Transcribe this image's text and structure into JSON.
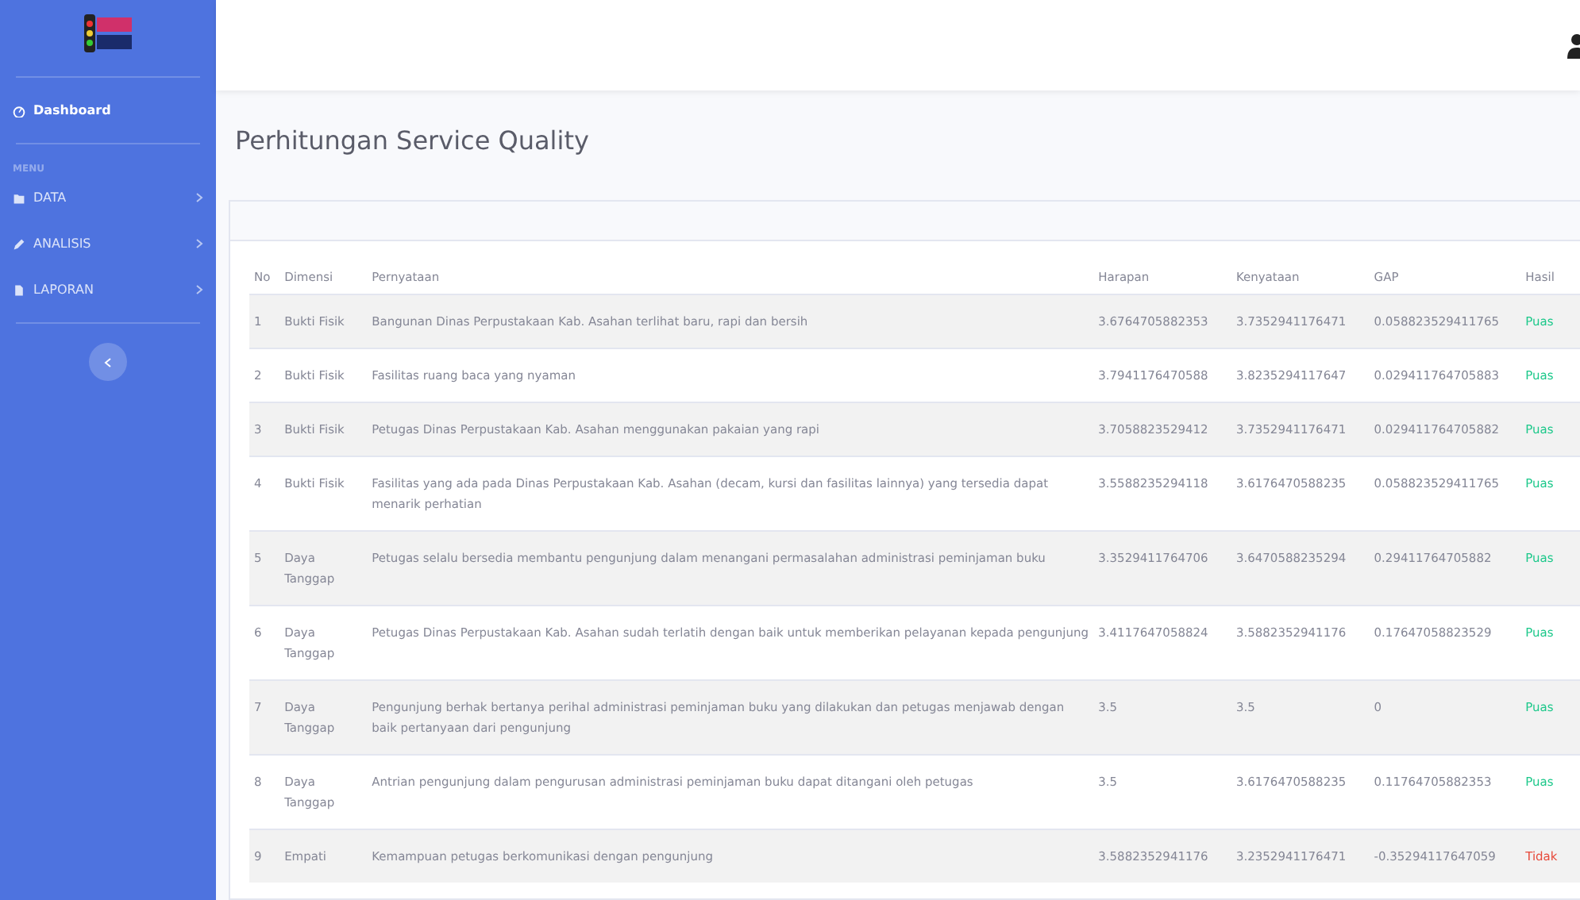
{
  "sidebar": {
    "items": [
      {
        "label": "Dashboard",
        "kind": "link",
        "selected": true
      },
      {
        "label": "MENU",
        "kind": "heading"
      },
      {
        "label": "DATA",
        "kind": "menu",
        "selected": false
      },
      {
        "label": "ANALISIS",
        "kind": "menu",
        "selected": false
      },
      {
        "label": "LAPORAN",
        "kind": "menu",
        "selected": false
      }
    ]
  },
  "page_title": "Perhitungan Service Quality",
  "table": {
    "columns": [
      "No",
      "Dimensi",
      "Pernyataan",
      "Harapan",
      "Kenyataan",
      "GAP",
      "Hasil"
    ],
    "rows": [
      {
        "no": "1",
        "dimensi": "Bukti Fisik",
        "pernyataan": "Bangunan Dinas Perpustakaan Kab. Asahan terlihat baru, rapi dan bersih",
        "harapan": "3.6764705882353",
        "kenyataan": "3.7352941176471",
        "gap": "0.058823529411765",
        "hasil": "Puas",
        "satisfied": true
      },
      {
        "no": "2",
        "dimensi": "Bukti Fisik",
        "pernyataan": "Fasilitas ruang baca yang nyaman",
        "harapan": "3.7941176470588",
        "kenyataan": "3.8235294117647",
        "gap": "0.029411764705883",
        "hasil": "Puas",
        "satisfied": true
      },
      {
        "no": "3",
        "dimensi": "Bukti Fisik",
        "pernyataan": "Petugas Dinas Perpustakaan Kab. Asahan menggunakan pakaian yang rapi",
        "harapan": "3.7058823529412",
        "kenyataan": "3.7352941176471",
        "gap": "0.029411764705882",
        "hasil": "Puas",
        "satisfied": true
      },
      {
        "no": "4",
        "dimensi": "Bukti Fisik",
        "pernyataan": "Fasilitas yang ada pada Dinas Perpustakaan Kab. Asahan (decam, kursi dan fasilitas lainnya) yang tersedia dapat menarik perhatian",
        "harapan": "3.5588235294118",
        "kenyataan": "3.6176470588235",
        "gap": "0.058823529411765",
        "hasil": "Puas",
        "satisfied": true
      },
      {
        "no": "5",
        "dimensi": "Daya Tanggap",
        "pernyataan": "Petugas selalu bersedia membantu pengunjung dalam menangani permasalahan administrasi peminjaman buku",
        "harapan": "3.3529411764706",
        "kenyataan": "3.6470588235294",
        "gap": "0.29411764705882",
        "hasil": "Puas",
        "satisfied": true
      },
      {
        "no": "6",
        "dimensi": "Daya Tanggap",
        "pernyataan": "Petugas Dinas Perpustakaan Kab. Asahan sudah terlatih dengan baik untuk memberikan pelayanan kepada pengunjung",
        "harapan": "3.4117647058824",
        "kenyataan": "3.5882352941176",
        "gap": "0.17647058823529",
        "hasil": "Puas",
        "satisfied": true
      },
      {
        "no": "7",
        "dimensi": "Daya Tanggap",
        "pernyataan": "Pengunjung berhak bertanya perihal administrasi peminjaman buku yang dilakukan dan petugas menjawab dengan baik pertanyaan dari pengunjung",
        "harapan": "3.5",
        "kenyataan": "3.5",
        "gap": "0",
        "hasil": "Puas",
        "satisfied": true
      },
      {
        "no": "8",
        "dimensi": "Daya Tanggap",
        "pernyataan": "Antrian pengunjung dalam pengurusan administrasi peminjaman buku dapat ditangani oleh petugas",
        "harapan": "3.5",
        "kenyataan": "3.6176470588235",
        "gap": "0.11764705882353",
        "hasil": "Puas",
        "satisfied": true
      },
      {
        "no": "9",
        "dimensi": "Empati",
        "pernyataan": "Kemampuan petugas berkomunikasi dengan pengunjung",
        "harapan": "3.5882352941176",
        "kenyataan": "3.2352941176471",
        "gap": "-0.35294117647059",
        "hasil": "Tidak",
        "satisfied": false
      }
    ]
  }
}
